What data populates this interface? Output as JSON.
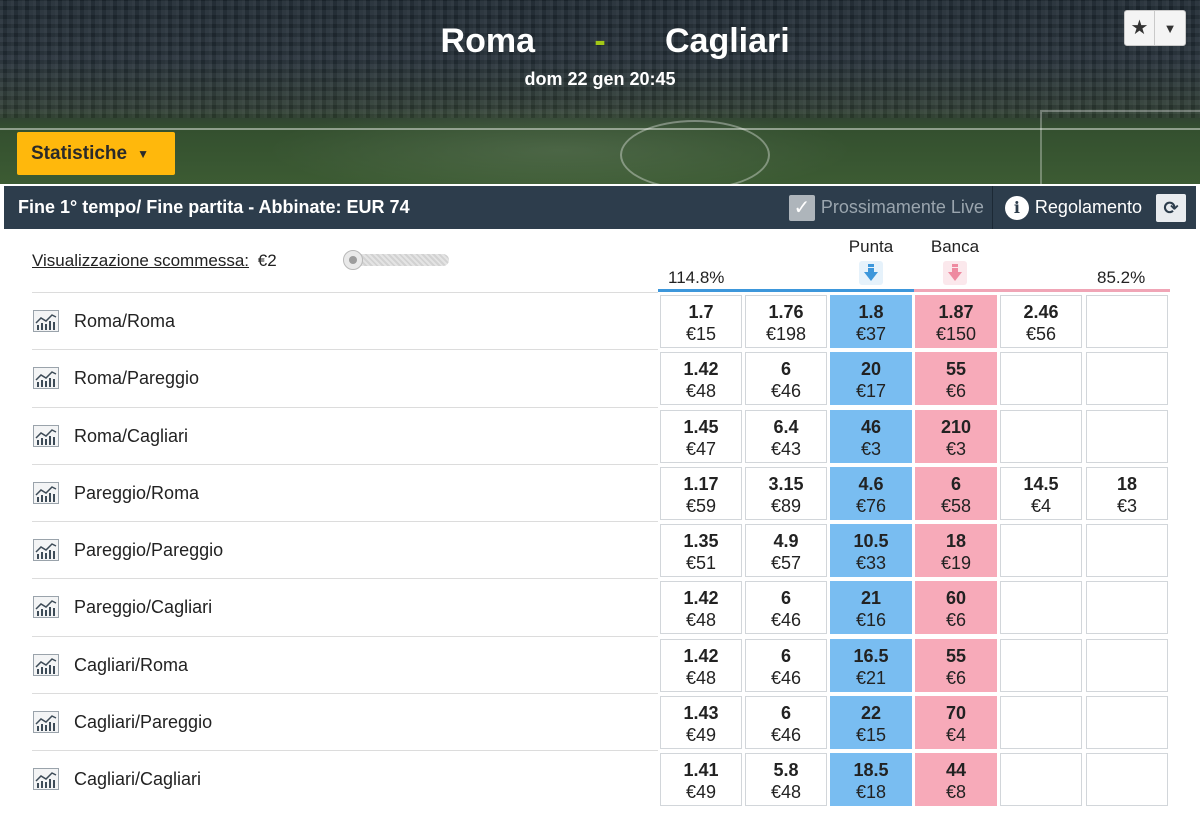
{
  "match": {
    "home": "Roma",
    "separator": "-",
    "away": "Cagliari",
    "datetime": "dom 22 gen 20:45"
  },
  "favorites_icon": "star-icon",
  "statistics_button": {
    "label": "Statistiche",
    "icon": "chevron-down-icon"
  },
  "market": {
    "title": "Fine 1° tempo/ Fine partita - Abbinate: EUR 74",
    "live_label": "Prossimamente Live",
    "live_checked": true,
    "rules_label": "Regolamento"
  },
  "controls": {
    "stake_label": "Visualizzazione scommessa:",
    "stake_value": "€2",
    "slider_level": 0,
    "back_book": "114.8%",
    "lay_book": "85.2%",
    "back_header": "Punta",
    "lay_header": "Banca"
  },
  "colors": {
    "back": "#79bdf1",
    "lay": "#f7aab9",
    "header_bar": "#2d3d4c",
    "stats_button": "#ffb80c",
    "accent_separator": "#a3c816"
  },
  "runners": [
    {
      "name": "Roma/Roma",
      "cells": [
        [
          "1.7",
          "€15"
        ],
        [
          "1.76",
          "€198"
        ],
        [
          "1.8",
          "€37"
        ],
        [
          "1.87",
          "€150"
        ],
        [
          "2.46",
          "€56"
        ],
        [
          "",
          ""
        ]
      ]
    },
    {
      "name": "Roma/Pareggio",
      "cells": [
        [
          "1.42",
          "€48"
        ],
        [
          "6",
          "€46"
        ],
        [
          "20",
          "€17"
        ],
        [
          "55",
          "€6"
        ],
        [
          "",
          ""
        ],
        [
          "",
          ""
        ]
      ]
    },
    {
      "name": "Roma/Cagliari",
      "cells": [
        [
          "1.45",
          "€47"
        ],
        [
          "6.4",
          "€43"
        ],
        [
          "46",
          "€3"
        ],
        [
          "210",
          "€3"
        ],
        [
          "",
          ""
        ],
        [
          "",
          ""
        ]
      ]
    },
    {
      "name": "Pareggio/Roma",
      "cells": [
        [
          "1.17",
          "€59"
        ],
        [
          "3.15",
          "€89"
        ],
        [
          "4.6",
          "€76"
        ],
        [
          "6",
          "€58"
        ],
        [
          "14.5",
          "€4"
        ],
        [
          "18",
          "€3"
        ]
      ]
    },
    {
      "name": "Pareggio/Pareggio",
      "cells": [
        [
          "1.35",
          "€51"
        ],
        [
          "4.9",
          "€57"
        ],
        [
          "10.5",
          "€33"
        ],
        [
          "18",
          "€19"
        ],
        [
          "",
          ""
        ],
        [
          "",
          ""
        ]
      ]
    },
    {
      "name": "Pareggio/Cagliari",
      "cells": [
        [
          "1.42",
          "€48"
        ],
        [
          "6",
          "€46"
        ],
        [
          "21",
          "€16"
        ],
        [
          "60",
          "€6"
        ],
        [
          "",
          ""
        ],
        [
          "",
          ""
        ]
      ]
    },
    {
      "name": "Cagliari/Roma",
      "cells": [
        [
          "1.42",
          "€48"
        ],
        [
          "6",
          "€46"
        ],
        [
          "16.5",
          "€21"
        ],
        [
          "55",
          "€6"
        ],
        [
          "",
          ""
        ],
        [
          "",
          ""
        ]
      ]
    },
    {
      "name": "Cagliari/Pareggio",
      "cells": [
        [
          "1.43",
          "€49"
        ],
        [
          "6",
          "€46"
        ],
        [
          "22",
          "€15"
        ],
        [
          "70",
          "€4"
        ],
        [
          "",
          ""
        ],
        [
          "",
          ""
        ]
      ]
    },
    {
      "name": "Cagliari/Cagliari",
      "cells": [
        [
          "1.41",
          "€49"
        ],
        [
          "5.8",
          "€48"
        ],
        [
          "18.5",
          "€18"
        ],
        [
          "44",
          "€8"
        ],
        [
          "",
          ""
        ],
        [
          "",
          ""
        ]
      ]
    }
  ]
}
